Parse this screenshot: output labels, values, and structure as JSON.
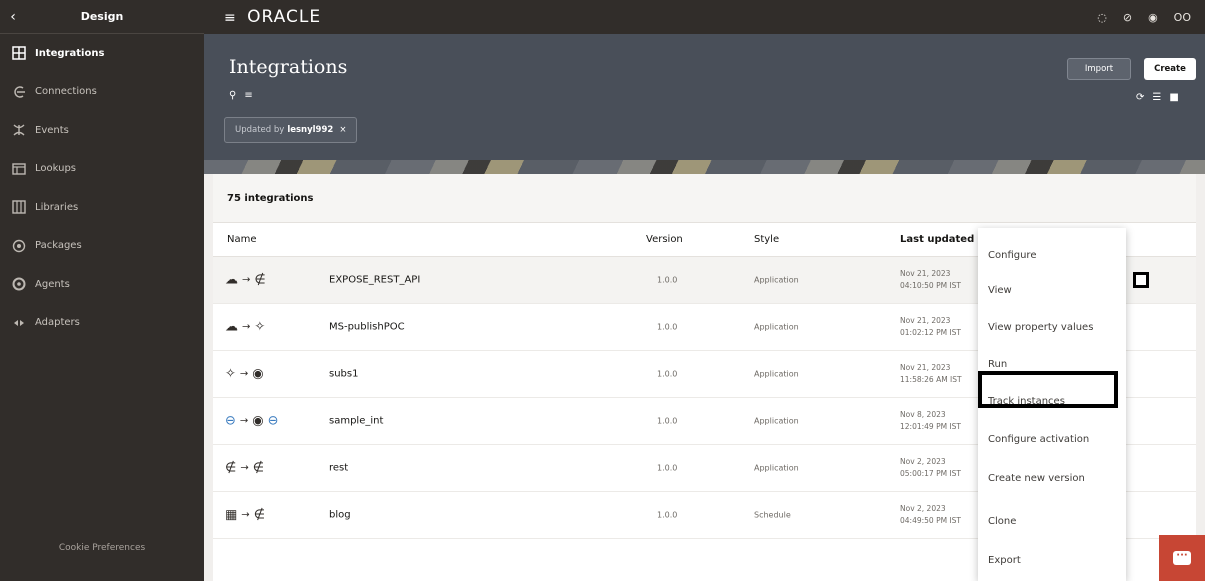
{
  "sidebar": {
    "back_icon": "chevron-left-icon",
    "title": "Design",
    "items": [
      {
        "label": "Integrations",
        "icon": "integrations-icon",
        "active": true
      },
      {
        "label": "Connections",
        "icon": "connections-icon"
      },
      {
        "label": "Events",
        "icon": "events-icon"
      },
      {
        "label": "Lookups",
        "icon": "lookups-icon"
      },
      {
        "label": "Libraries",
        "icon": "libraries-icon"
      },
      {
        "label": "Packages",
        "icon": "packages-icon"
      },
      {
        "label": "Agents",
        "icon": "agents-icon"
      },
      {
        "label": "Adapters",
        "icon": "adapters-icon"
      }
    ],
    "cookie_label": "Cookie Preferences"
  },
  "topbar": {
    "brand": "ORACLE",
    "user_initials": "OO"
  },
  "header": {
    "title": "Integrations",
    "filter_prefix": "Updated by",
    "filter_value": "lesnyl992",
    "import_label": "Import",
    "create_label": "Create"
  },
  "list": {
    "count_label": "75 integrations",
    "columns": {
      "name": "Name",
      "version": "Version",
      "style": "Style",
      "last_updated": "Last updated"
    },
    "rows": [
      {
        "name": "EXPOSE_REST_API",
        "version": "1.0.0",
        "style": "Application",
        "date": "Nov 21, 2023",
        "time": "04:10:50 PM IST"
      },
      {
        "name": "MS-publishPOC",
        "version": "1.0.0",
        "style": "Application",
        "date": "Nov 21, 2023",
        "time": "01:02:12 PM IST"
      },
      {
        "name": "subs1",
        "version": "1.0.0",
        "style": "Application",
        "date": "Nov 21, 2023",
        "time": "11:58:26 AM IST"
      },
      {
        "name": "sample_int",
        "version": "1.0.0",
        "style": "Application",
        "date": "Nov 8, 2023",
        "time": "12:01:49 PM IST"
      },
      {
        "name": "rest",
        "version": "1.0.0",
        "style": "Application",
        "date": "Nov 2, 2023",
        "time": "05:00:17 PM IST"
      },
      {
        "name": "blog",
        "version": "1.0.0",
        "style": "Schedule",
        "date": "Nov 2, 2023",
        "time": "04:49:50 PM IST"
      }
    ]
  },
  "context_menu": {
    "items": [
      "Configure",
      "View",
      "View property values",
      "Run",
      "Track instances",
      "Configure activation",
      "Create new version",
      "Clone",
      "Export"
    ]
  }
}
